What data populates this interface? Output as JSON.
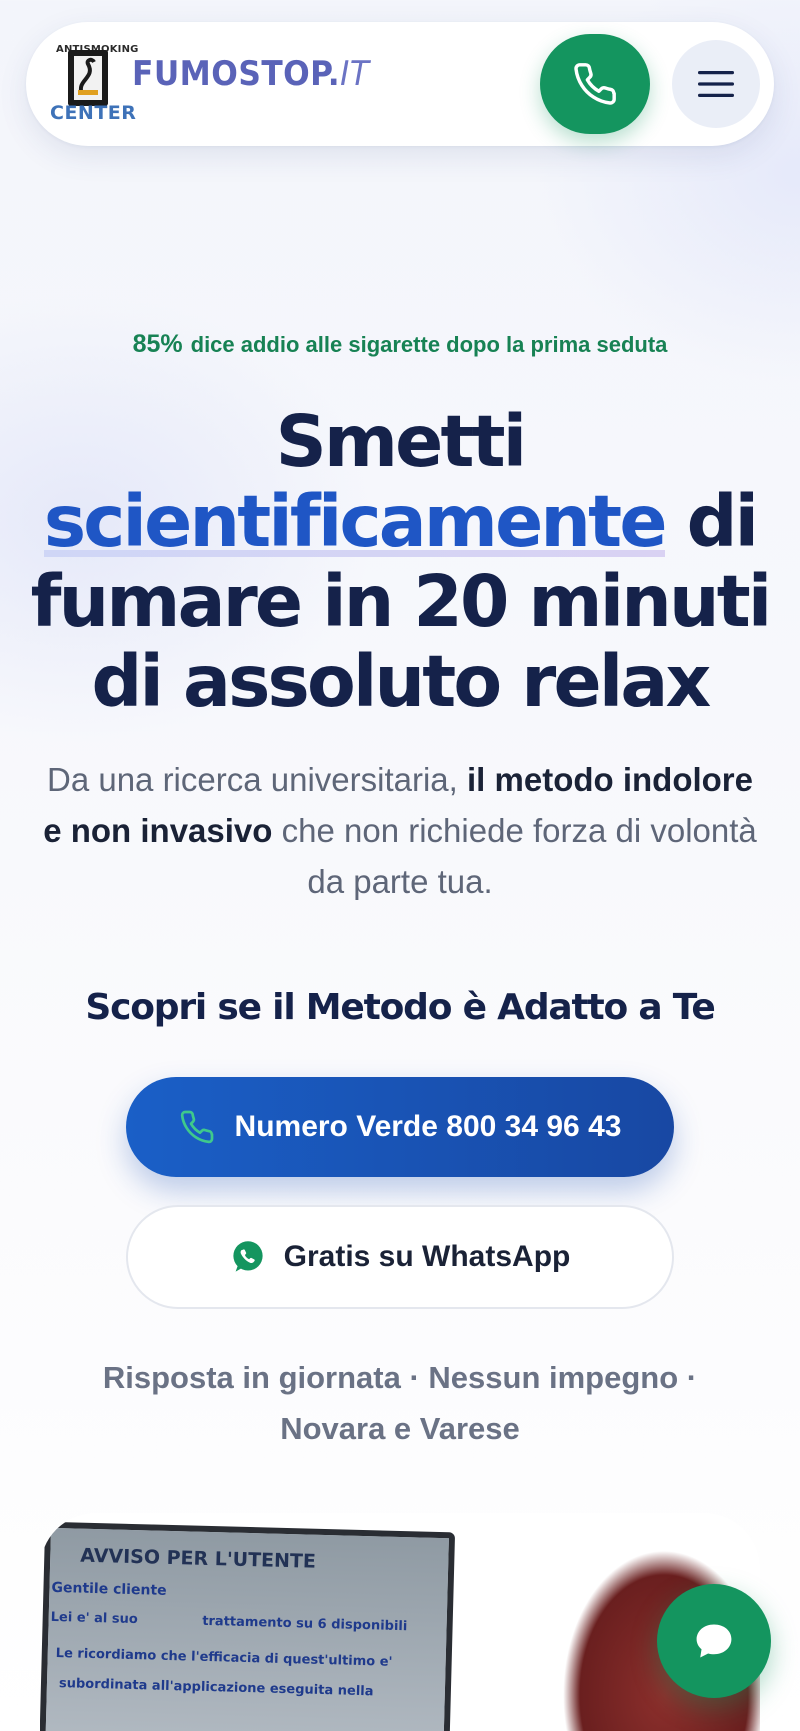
{
  "header": {
    "logo": {
      "top_text": "ANTISMOKING",
      "bottom_text": "CENTER",
      "brand_name": "FUMOSTOP.",
      "brand_tld": "IT"
    },
    "call_icon": "phone-icon",
    "menu_icon": "hamburger-menu-icon"
  },
  "hero": {
    "kicker_pct": "85%",
    "kicker_text": "dice addio alle sigarette dopo la prima seduta",
    "headline_part1": "Smetti",
    "headline_highlight": "scientificamente",
    "headline_part2": "di fumare in 20 minuti di assoluto relax",
    "sub_part1": "Da una ricerca universitaria,",
    "sub_bold": "il metodo indolore e non invasivo",
    "sub_part2": "che non richiede forza di volontà da parte tua."
  },
  "cta": {
    "heading": "Scopri se il Metodo è Adatto a Te",
    "primary_label": "Numero Verde 800 34 96 43",
    "primary_icon": "phone-icon",
    "secondary_label": "Gratis su WhatsApp",
    "secondary_icon": "whatsapp-icon",
    "meta_line1": "Risposta in giornata · Nessun impegno ·",
    "meta_line2": "Novara e Varese"
  },
  "media": {
    "screen_title": "AVVISO PER L'UTENTE",
    "screen_line1": "Gentile cliente",
    "screen_line2": "Lei e' al suo",
    "screen_line2b": "trattamento su 6 disponibili",
    "screen_line3": "Le ricordiamo che l'efficacia di quest'ultimo e'",
    "screen_line4": "subordinata all'applicazione eseguita nella"
  },
  "chat": {
    "icon": "chat-bubble-icon"
  },
  "colors": {
    "brand_green": "#14955f",
    "brand_blue": "#1a5fc7",
    "heading_navy": "#15224a",
    "highlight_blue": "#1f56c5"
  }
}
